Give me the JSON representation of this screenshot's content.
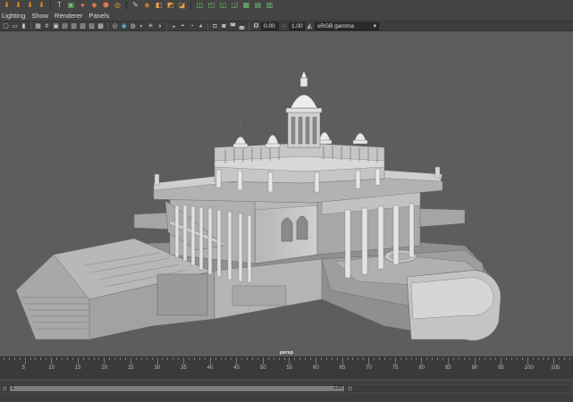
{
  "shelf": {
    "icons": [
      {
        "name": "arrow-down-icon",
        "glyph": "⬇",
        "color": "#e28a2b"
      },
      {
        "name": "arrow-down-icon",
        "glyph": "⬇",
        "color": "#e28a2b"
      },
      {
        "name": "arrow-down-icon",
        "glyph": "⬇",
        "color": "#e28a2b"
      },
      {
        "name": "arrow-down-icon",
        "glyph": "⬇",
        "color": "#e28a2b"
      },
      {
        "name": "text-tool-icon",
        "glyph": "T",
        "color": "#e8c04a"
      },
      {
        "name": "layout-tool-icon",
        "glyph": "▣",
        "color": "#6cc26c"
      },
      {
        "name": "sphere-icon",
        "glyph": "●",
        "color": "#d97a4a"
      },
      {
        "name": "cube-icon",
        "glyph": "◆",
        "color": "#d97a4a"
      },
      {
        "name": "cylinder-icon",
        "glyph": "⬢",
        "color": "#d97a4a"
      },
      {
        "name": "torus-icon",
        "glyph": "◎",
        "color": "#e8a040"
      },
      {
        "name": "sculpt-tool-icon",
        "glyph": "✎",
        "color": "#c9c9c9"
      },
      {
        "name": "paint-tool-icon",
        "glyph": "◈",
        "color": "#e28a2b"
      },
      {
        "name": "extrude-icon",
        "glyph": "◧",
        "color": "#e8a040"
      },
      {
        "name": "bevel-icon",
        "glyph": "◩",
        "color": "#e8a040"
      },
      {
        "name": "bridge-icon",
        "glyph": "◪",
        "color": "#e8a040"
      },
      {
        "name": "combine-icon",
        "glyph": "◫",
        "color": "#6cc26c"
      },
      {
        "name": "separate-icon",
        "glyph": "◰",
        "color": "#6cc26c"
      },
      {
        "name": "mirror-icon",
        "glyph": "◱",
        "color": "#6cc26c"
      },
      {
        "name": "smooth-icon",
        "glyph": "◲",
        "color": "#6cc26c"
      },
      {
        "name": "checker-icon",
        "glyph": "▦",
        "color": "#6cc26c"
      },
      {
        "name": "uv-editor-icon",
        "glyph": "▤",
        "color": "#6cc26c"
      },
      {
        "name": "grid-icon",
        "glyph": "▥",
        "color": "#6cc26c"
      }
    ]
  },
  "menu": {
    "items": [
      "Lighting",
      "Show",
      "Renderer",
      "Panels"
    ]
  },
  "toolbar": {
    "exposure_value": "0.00",
    "gamma_value": "1.00",
    "color_space": "sRGB gamma"
  },
  "viewport": {
    "camera_label": "persp",
    "background_color": "#5d5d5d"
  },
  "timeline": {
    "tick_labels": [
      "5",
      "10",
      "15",
      "20",
      "25",
      "30",
      "35",
      "40",
      "45",
      "50",
      "55",
      "60",
      "65",
      "70",
      "75",
      "80",
      "85",
      "90",
      "95",
      "100",
      "105"
    ]
  },
  "range": {
    "start_value": "1",
    "end_value": "120"
  }
}
